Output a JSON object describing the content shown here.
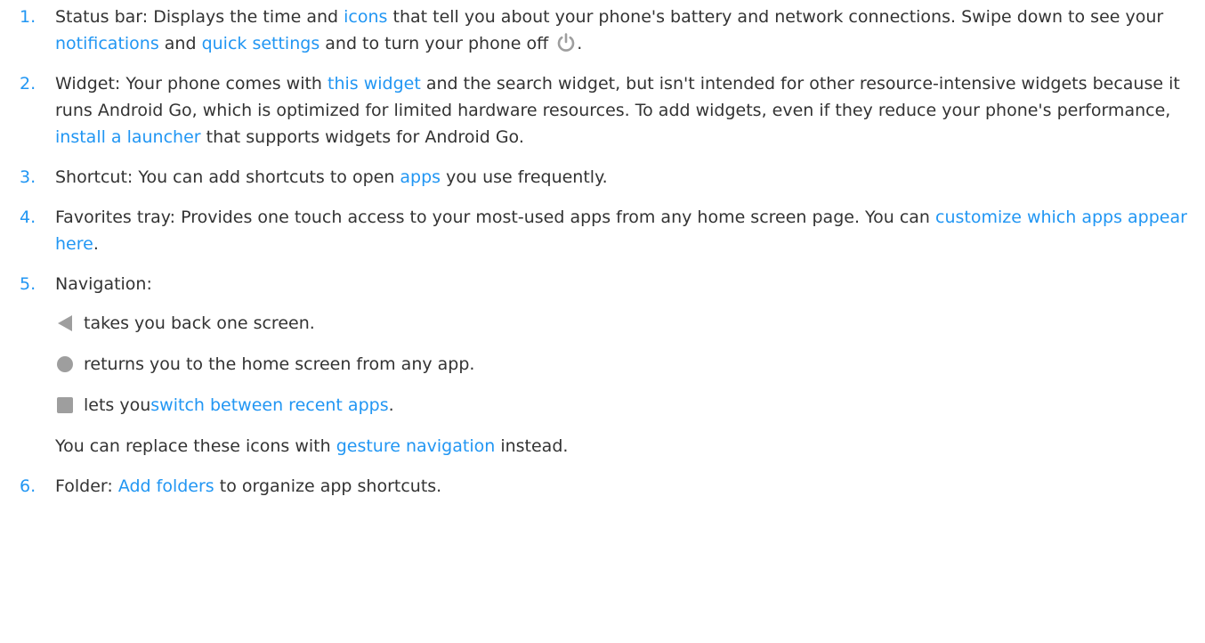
{
  "items": [
    {
      "number": "1.",
      "text_a": "Status bar: Displays the time and ",
      "link_icons": "icons",
      "text_b": " that tell you about your phone's battery and network connections. Swipe down to see your ",
      "link_notifications": "notifications",
      "text_c": " and ",
      "link_quick_settings": "quick settings",
      "text_d": " and to turn your phone off ",
      "text_end": "."
    },
    {
      "number": "2.",
      "text_a": "Widget: Your phone comes with ",
      "link_widget": "this widget",
      "text_b": " and the search widget, but isn't intended for other resource-intensive widgets because it runs Android Go, which is optimized for limited hardware resources. To add widgets, even if they reduce your phone's performance, ",
      "link_launcher": "install a launcher",
      "text_c": " that supports widgets for Android Go."
    },
    {
      "number": "3.",
      "text_a": "Shortcut: You can add shortcuts to open ",
      "link_apps": "apps",
      "text_b": " you use frequently."
    },
    {
      "number": "4.",
      "text_a": "Favorites tray: Provides one touch access to your most-used apps from any home screen page. You can ",
      "link_customize": "customize which apps appear here",
      "text_end": "."
    },
    {
      "number": "5.",
      "text_a": "Navigation:",
      "back_text": "takes you back one screen.",
      "home_text": "returns you to the home screen from any app.",
      "recent_text_a": "lets you ",
      "link_switch": "switch between recent apps",
      "recent_text_end": ".",
      "note_a": "You can replace these icons with ",
      "link_gesture": "gesture navigation",
      "note_b": " instead."
    },
    {
      "number": "6.",
      "text_a": "Folder: ",
      "link_folders": "Add folders",
      "text_b": " to organize app shortcuts."
    }
  ],
  "icons": {
    "power": "power-icon",
    "back": "back-triangle-icon",
    "home": "home-circle-icon",
    "recent": "recent-square-icon"
  },
  "colors": {
    "link": "#2196f3",
    "text": "#333333",
    "icon_gray": "#9e9e9e"
  }
}
